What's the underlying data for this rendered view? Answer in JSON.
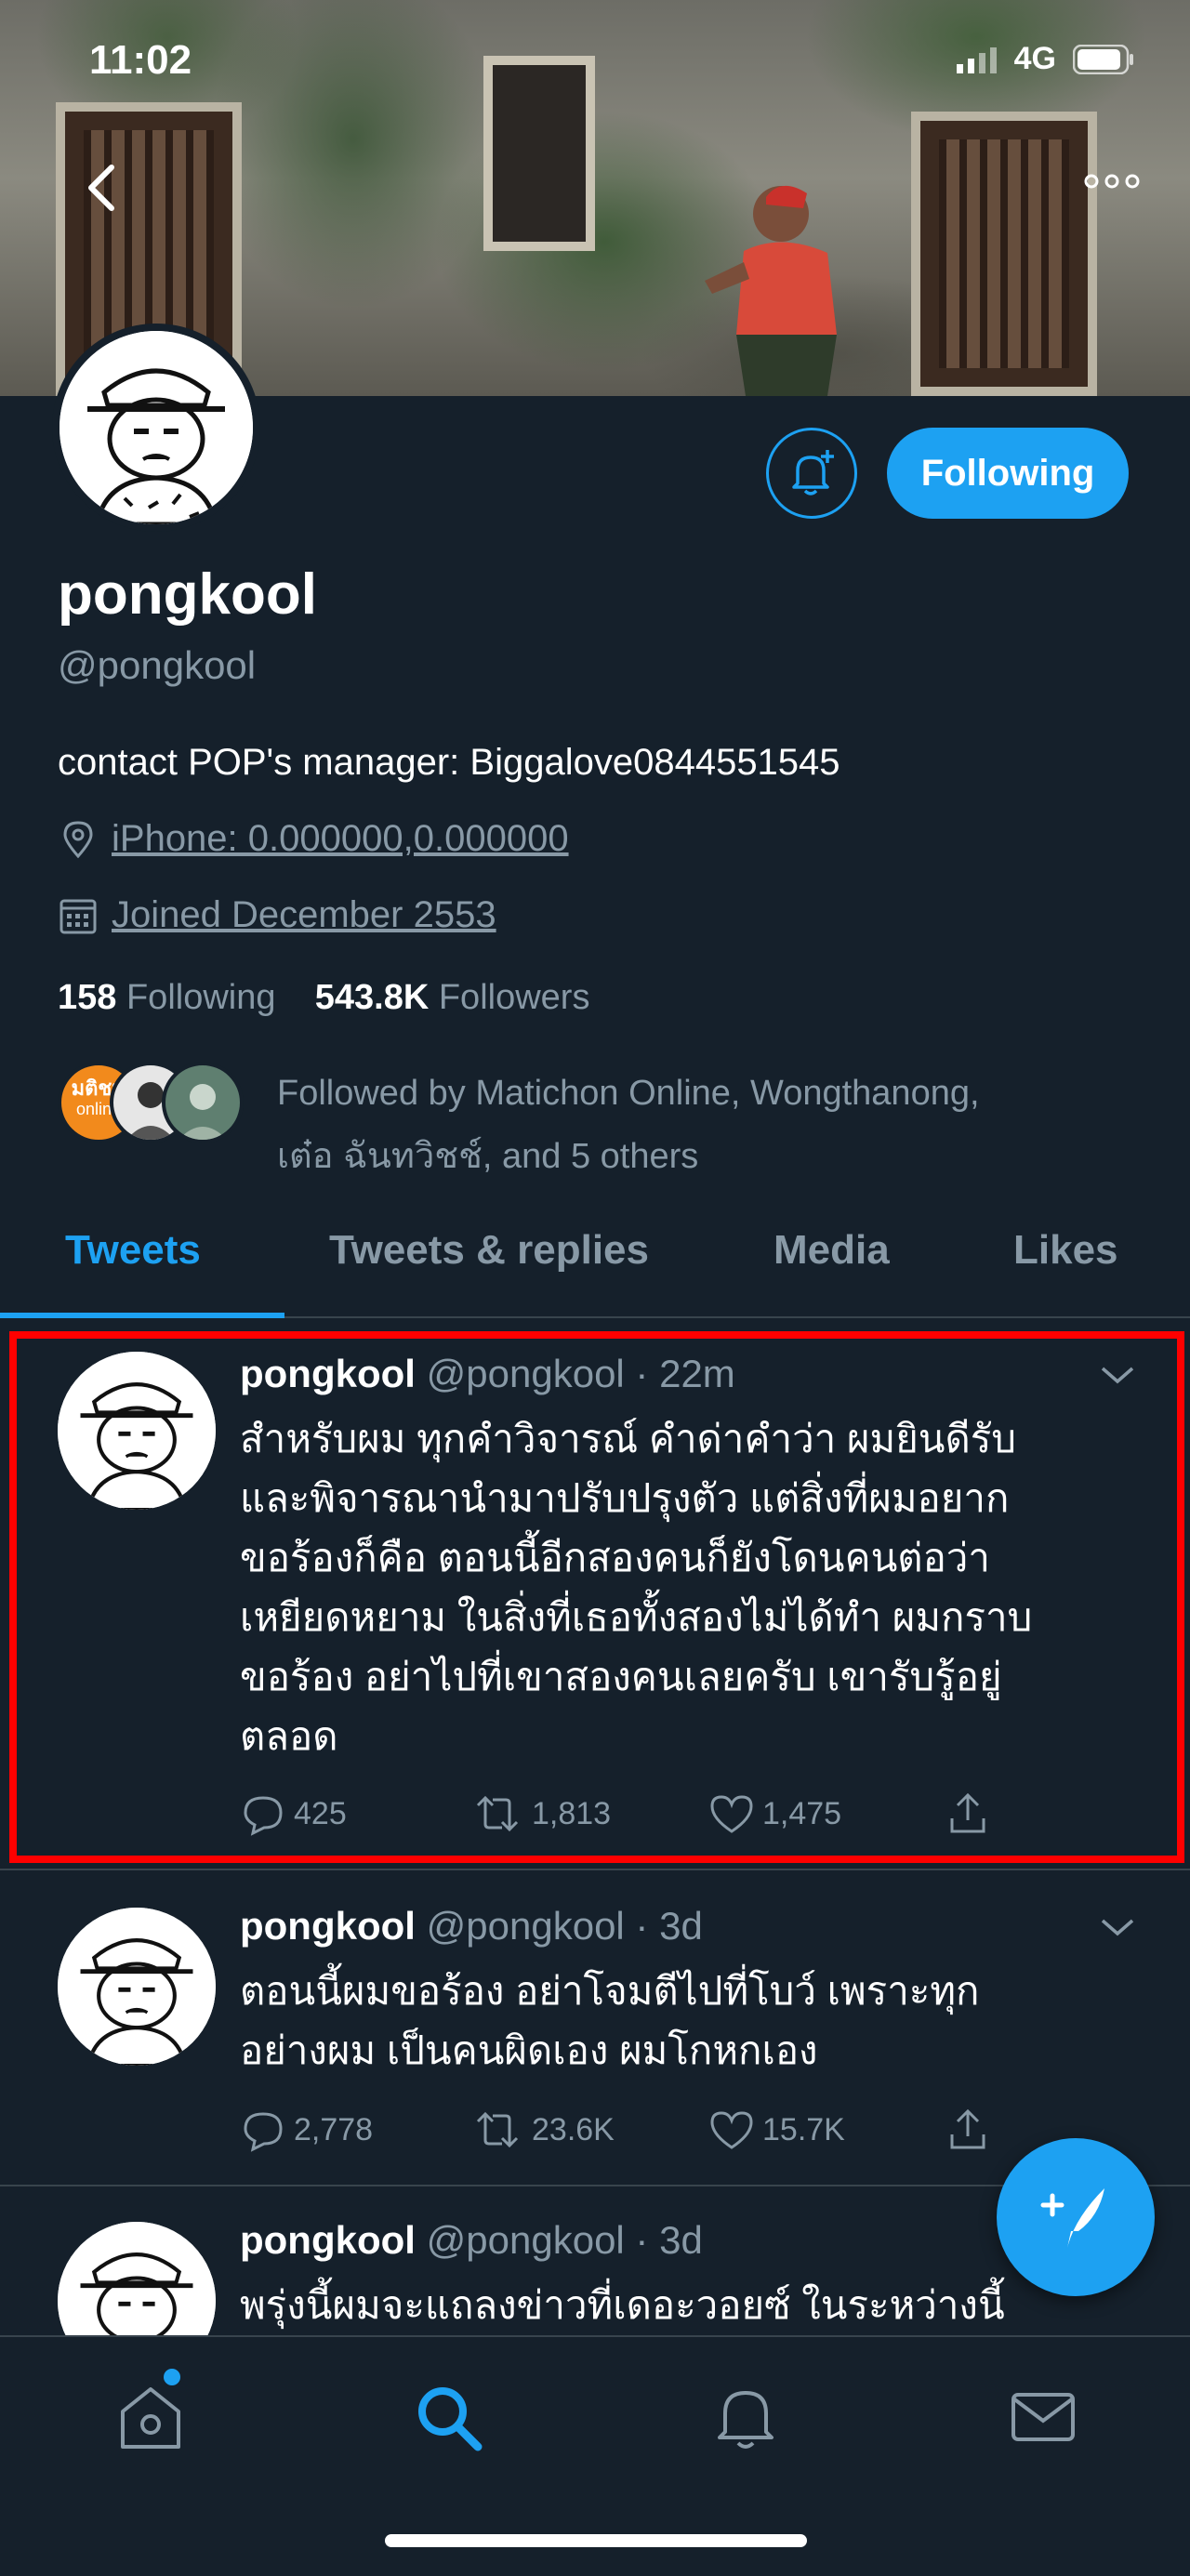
{
  "status_bar": {
    "time": "11:02",
    "network": "4G"
  },
  "profile": {
    "display_name": "pongkool",
    "handle": "@pongkool",
    "bio": "contact POP's manager: Biggalove0844551545",
    "location": "iPhone: 0.000000,0.000000",
    "joined": "Joined December 2553",
    "following_count": "158",
    "following_label": "Following",
    "followers_count": "543.8K",
    "followers_label": "Followers",
    "followed_by_line1": "Followed by Matichon Online, Wongthanong,",
    "followed_by_line2": "เต๋อ ฉันทวิชช์, and 5 others",
    "follow_button_label": "Following",
    "matichon_badge_line1": "มติชน",
    "matichon_badge_line2": "online"
  },
  "tabs": [
    {
      "label": "Tweets",
      "active": true
    },
    {
      "label": "Tweets & replies",
      "active": false
    },
    {
      "label": "Media",
      "active": false
    },
    {
      "label": "Likes",
      "active": false
    }
  ],
  "tweets": [
    {
      "name": "pongkool",
      "handle_time": "@pongkool · 22m",
      "lines": [
        "สำหรับผม ทุกคำวิจารณ์ คำด่าคำว่า ผมยินดีรับ",
        "และพิจารณานำมาปรับปรุงตัว แต่สิ่งที่ผมอยาก",
        "ขอร้องก็คือ ตอนนี้อีกสองคนก็ยังโดนคนต่อว่า",
        "เหยียดหยาม ในสิ่งที่เธอทั้งสองไม่ได้ทำ ผมกราบ",
        "ขอร้อง อย่าไปที่เขาสองคนเลยครับ เขารับรู้อยู่",
        "ตลอด"
      ],
      "replies": "425",
      "retweets": "1,813",
      "likes": "1,475"
    },
    {
      "name": "pongkool",
      "handle_time": "@pongkool · 3d",
      "lines": [
        "ตอนนี้ผมขอร้อง อย่าโจมตีไปที่โบว์ เพราะทุก",
        "อย่างผม เป็นคนผิดเอง ผมโกหกเอง"
      ],
      "replies": "2,778",
      "retweets": "23.6K",
      "likes": "15.7K"
    },
    {
      "name": "pongkool",
      "handle_time": "@pongkool · 3d",
      "lines": [
        "พรุ่งนี้ผมจะแถลงข่าวที่เดอะวอยซ์ ในระหว่างนี้"
      ]
    }
  ],
  "icons": {
    "back": "chevron-left-icon",
    "more": "more-icon",
    "bell": "bell-plus-icon",
    "location": "location-pin-icon",
    "calendar": "calendar-icon",
    "reply": "reply-icon",
    "retweet": "retweet-icon",
    "like": "heart-icon",
    "share": "share-icon",
    "compose": "compose-icon",
    "home": "home-icon",
    "search": "search-icon",
    "notifications": "bell-icon",
    "messages": "mail-icon"
  },
  "colors": {
    "accent": "#1da1f2",
    "background": "#15202b",
    "muted": "#8899a6",
    "divider": "#38444d",
    "highlight": "#ff0000"
  }
}
